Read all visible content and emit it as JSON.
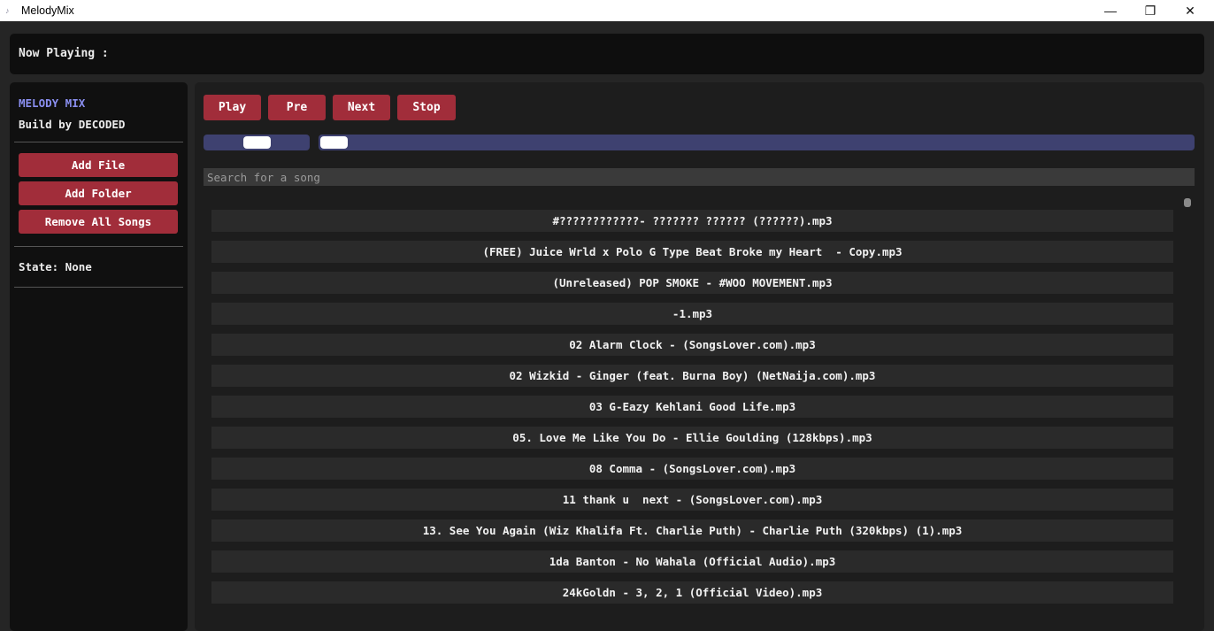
{
  "window": {
    "title": "MelodyMix",
    "app_icon": "music-icon",
    "controls": {
      "minimize": "—",
      "maximize": "❐",
      "close": "✕"
    }
  },
  "now_playing": {
    "label": "Now Playing :"
  },
  "sidebar": {
    "brand": "MELODY MIX",
    "build": "Build by DECODED",
    "buttons": {
      "add_file": "Add File",
      "add_folder": "Add Folder",
      "remove_all": "Remove All Songs"
    },
    "state": "State: None"
  },
  "controls": {
    "play": "Play",
    "pre": "Pre",
    "next": "Next",
    "stop": "Stop"
  },
  "sliders": {
    "volume_level": 0.5,
    "progress": 0.0
  },
  "search": {
    "placeholder": "Search for a song",
    "value": ""
  },
  "colors": {
    "accent_button": "#a12d3a",
    "slider_track": "#3e4170",
    "brand_text": "#8a8ff0"
  },
  "songs": [
    "#????????????- ??????? ?????? (??????).mp3",
    "(FREE) Juice Wrld x Polo G Type Beat Broke my Heart  - Copy.mp3",
    "(Unreleased) POP SMOKE - #WOO MOVEMENT.mp3",
    "-1.mp3",
    "02 Alarm Clock - (SongsLover.com).mp3",
    "02 Wizkid - Ginger (feat. Burna Boy) (NetNaija.com).mp3",
    "03 G-Eazy Kehlani Good Life.mp3",
    "05. Love Me Like You Do - Ellie Goulding (128kbps).mp3",
    "08 Comma - (SongsLover.com).mp3",
    "11 thank u  next - (SongsLover.com).mp3",
    "13. See You Again (Wiz Khalifa Ft. Charlie Puth) - Charlie Puth (320kbps) (1).mp3",
    "1da Banton - No Wahala (Official Audio).mp3",
    "24kGoldn - 3, 2, 1 (Official Video).mp3"
  ]
}
